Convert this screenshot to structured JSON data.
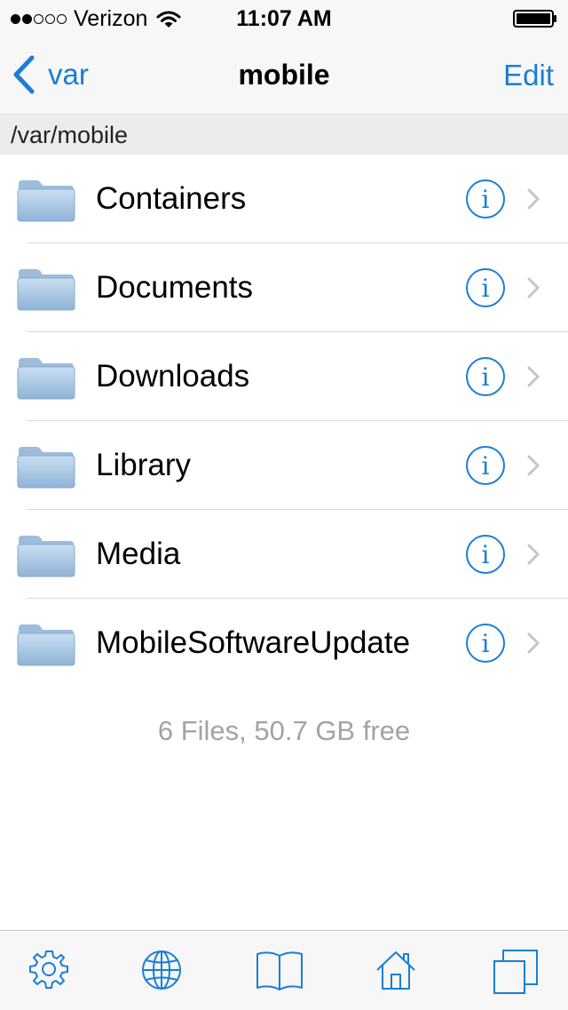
{
  "status_bar": {
    "carrier": "Verizon",
    "time": "11:07 AM",
    "signal_bars_filled": 2,
    "signal_bars_total": 5
  },
  "nav": {
    "back_label": "var",
    "title": "mobile",
    "edit_label": "Edit"
  },
  "path": "/var/mobile",
  "files": [
    {
      "name": "Containers",
      "icon": "folder-icon"
    },
    {
      "name": "Documents",
      "icon": "folder-icon"
    },
    {
      "name": "Downloads",
      "icon": "folder-icon"
    },
    {
      "name": "Library",
      "icon": "folder-icon"
    },
    {
      "name": "Media",
      "icon": "folder-icon"
    },
    {
      "name": "MobileSoftwareUpdate",
      "icon": "folder-icon"
    }
  ],
  "footer": "6 Files, 50.7 GB free",
  "tab_bar": {
    "tabs": [
      "settings-icon",
      "globe-icon",
      "book-icon",
      "home-icon",
      "windows-icon"
    ]
  },
  "colors": {
    "accent": "#1a7ed6",
    "bar_background": "#f7f7f7",
    "footer_text": "#a3a3a3"
  }
}
